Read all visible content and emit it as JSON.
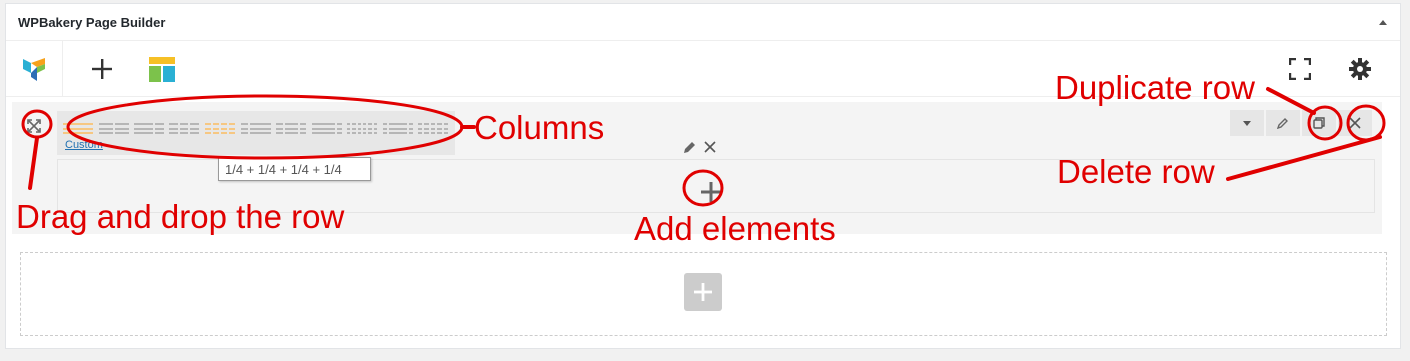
{
  "panel": {
    "title": "WPBakery Page Builder"
  },
  "row": {
    "custom_label": "Custom",
    "tooltip": "1/4 + 1/4 + 1/4 + 1/4"
  },
  "annotations": {
    "columns": "Columns",
    "drag": "Drag and drop the row",
    "add_elements": "Add elements",
    "duplicate_row": "Duplicate row",
    "delete_row": "Delete row"
  },
  "colors": {
    "annotation": "#e00000",
    "layout_active": "#f6c782",
    "link": "#2271b1"
  },
  "icons": [
    "vc-logo-icon",
    "plus-icon",
    "templates-icon",
    "fullscreen-icon",
    "gear-icon",
    "collapse-icon",
    "move-icon",
    "chevron-down-icon",
    "pencil-icon",
    "duplicate-icon",
    "close-icon"
  ]
}
